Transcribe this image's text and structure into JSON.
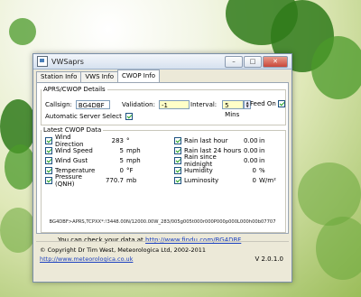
{
  "window": {
    "title": "VWSaprs",
    "btn_min": "–",
    "btn_max": "□",
    "btn_close": "✕"
  },
  "tabs": [
    "Station Info",
    "VWS Info",
    "CWOP Info"
  ],
  "details": {
    "legend": "APRS/CWOP Details",
    "callsign_label": "Callsign:",
    "callsign_value": "BG4DBF",
    "validation_label": "Validation:",
    "validation_value": "-1",
    "interval_label": "Interval:",
    "interval_value": "5 Mins",
    "feed_label": "Feed On",
    "auto_label": "Automatic Server Select"
  },
  "latest": {
    "legend": "Latest CWOP Data",
    "left": [
      {
        "name": "Wind Direction",
        "value": "283",
        "unit": "°"
      },
      {
        "name": "Wind Speed",
        "value": "5",
        "unit": "mph"
      },
      {
        "name": "Wind Gust",
        "value": "5",
        "unit": "mph"
      },
      {
        "name": "Temperature",
        "value": "0",
        "unit": "°F"
      },
      {
        "name": "Pressure (QNH)",
        "value": "770.7",
        "unit": "mb"
      }
    ],
    "right": [
      {
        "name": "Rain last hour",
        "value": "0.00",
        "unit": "in"
      },
      {
        "name": "Rain last 24 hours",
        "value": "0.00",
        "unit": "in"
      },
      {
        "name": "Rain since midnight",
        "value": "0.00",
        "unit": "in"
      },
      {
        "name": "Humidity",
        "value": "0",
        "unit": "%"
      },
      {
        "name": "Luminosity",
        "value": "0",
        "unit": "W/m²"
      }
    ],
    "packet": "BG4DBF>APRS,TCPXX*:!3448.00N/12000.00W_283/005g005t000r000P000p000L000h00b07707"
  },
  "check": {
    "text": "You can check your data at",
    "url": "http://www.findu.com/BG4DBF"
  },
  "footer": {
    "copyright": "© Copyright Dr Tim West, Meteorologica Ltd, 2002-2011",
    "website": "http://www.meteorologica.co.uk",
    "version": "V 2.0.1.0"
  }
}
